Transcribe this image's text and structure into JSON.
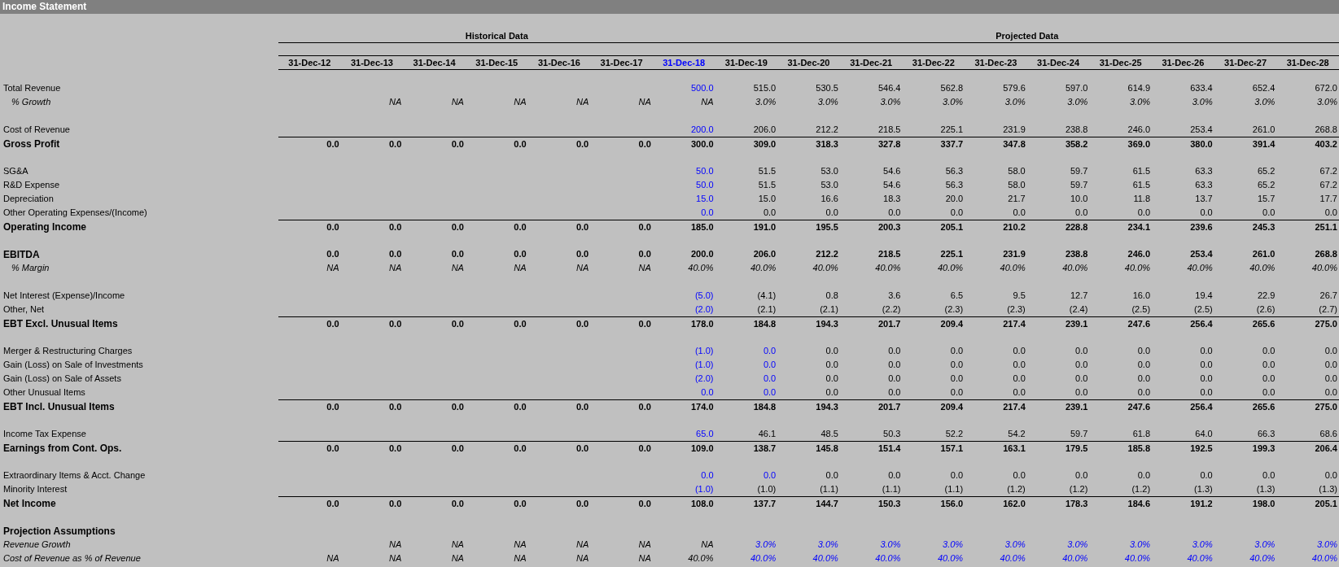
{
  "title": "Income Statement",
  "column_groups": [
    {
      "label": "Historical Data",
      "columns": [
        {
          "label": "31-Dec-12",
          "input": false
        },
        {
          "label": "31-Dec-13",
          "input": false
        },
        {
          "label": "31-Dec-14",
          "input": false
        },
        {
          "label": "31-Dec-15",
          "input": false
        },
        {
          "label": "31-Dec-16",
          "input": false
        },
        {
          "label": "31-Dec-17",
          "input": false
        },
        {
          "label": "31-Dec-18",
          "input": true
        }
      ]
    },
    {
      "label": "Projected Data",
      "columns": [
        {
          "label": "31-Dec-19",
          "input": false
        },
        {
          "label": "31-Dec-20",
          "input": false
        },
        {
          "label": "31-Dec-21",
          "input": false
        },
        {
          "label": "31-Dec-22",
          "input": false
        },
        {
          "label": "31-Dec-23",
          "input": false
        },
        {
          "label": "31-Dec-24",
          "input": false
        },
        {
          "label": "31-Dec-25",
          "input": false
        },
        {
          "label": "31-Dec-26",
          "input": false
        },
        {
          "label": "31-Dec-27",
          "input": false
        },
        {
          "label": "31-Dec-28",
          "input": false
        }
      ]
    }
  ],
  "rows": [
    {
      "kind": "item",
      "label": "Total Revenue",
      "cells": [
        null,
        null,
        null,
        null,
        null,
        null,
        {
          "text": "500.0",
          "input": true
        },
        "515.0",
        "530.5",
        "546.4",
        "562.8",
        "579.6",
        "597.0",
        "614.9",
        "633.4",
        "652.4",
        "672.0"
      ]
    },
    {
      "kind": "ratio",
      "label": "% Growth",
      "cells": [
        null,
        "NA",
        "NA",
        "NA",
        "NA",
        "NA",
        "NA",
        "3.0%",
        "3.0%",
        "3.0%",
        "3.0%",
        "3.0%",
        "3.0%",
        "3.0%",
        "3.0%",
        "3.0%",
        "3.0%"
      ]
    },
    {
      "kind": "spacer"
    },
    {
      "kind": "item",
      "label": "Cost of Revenue",
      "cells": [
        null,
        null,
        null,
        null,
        null,
        null,
        {
          "text": "200.0",
          "input": true
        },
        "206.0",
        "212.2",
        "218.5",
        "225.1",
        "231.9",
        "238.8",
        "246.0",
        "253.4",
        "261.0",
        "268.8"
      ]
    },
    {
      "kind": "total",
      "label": "Gross Profit",
      "cells": [
        "0.0",
        "0.0",
        "0.0",
        "0.0",
        "0.0",
        "0.0",
        "300.0",
        "309.0",
        "318.3",
        "327.8",
        "337.7",
        "347.8",
        "358.2",
        "369.0",
        "380.0",
        "391.4",
        "403.2"
      ]
    },
    {
      "kind": "spacer"
    },
    {
      "kind": "item",
      "label": "SG&A",
      "cells": [
        null,
        null,
        null,
        null,
        null,
        null,
        {
          "text": "50.0",
          "input": true
        },
        "51.5",
        "53.0",
        "54.6",
        "56.3",
        "58.0",
        "59.7",
        "61.5",
        "63.3",
        "65.2",
        "67.2"
      ]
    },
    {
      "kind": "item",
      "label": "R&D Expense",
      "cells": [
        null,
        null,
        null,
        null,
        null,
        null,
        {
          "text": "50.0",
          "input": true
        },
        "51.5",
        "53.0",
        "54.6",
        "56.3",
        "58.0",
        "59.7",
        "61.5",
        "63.3",
        "65.2",
        "67.2"
      ]
    },
    {
      "kind": "item",
      "label": "Depreciation",
      "cells": [
        null,
        null,
        null,
        null,
        null,
        null,
        {
          "text": "15.0",
          "input": true
        },
        "15.0",
        "16.6",
        "18.3",
        "20.0",
        "21.7",
        "10.0",
        "11.8",
        "13.7",
        "15.7",
        "17.7"
      ]
    },
    {
      "kind": "item",
      "label": "Other Operating Expenses/(Income)",
      "cells": [
        null,
        null,
        null,
        null,
        null,
        null,
        {
          "text": "0.0",
          "input": true
        },
        "0.0",
        "0.0",
        "0.0",
        "0.0",
        "0.0",
        "0.0",
        "0.0",
        "0.0",
        "0.0",
        "0.0"
      ]
    },
    {
      "kind": "total",
      "label": "Operating Income",
      "cells": [
        "0.0",
        "0.0",
        "0.0",
        "0.0",
        "0.0",
        "0.0",
        "185.0",
        "191.0",
        "195.5",
        "200.3",
        "205.1",
        "210.2",
        "228.8",
        "234.1",
        "239.6",
        "245.3",
        "251.1"
      ]
    },
    {
      "kind": "spacer"
    },
    {
      "kind": "subtotal",
      "label": "EBITDA",
      "cells": [
        "0.0",
        "0.0",
        "0.0",
        "0.0",
        "0.0",
        "0.0",
        "200.0",
        "206.0",
        "212.2",
        "218.5",
        "225.1",
        "231.9",
        "238.8",
        "246.0",
        "253.4",
        "261.0",
        "268.8"
      ]
    },
    {
      "kind": "ratio",
      "label": "% Margin",
      "cells": [
        "NA",
        "NA",
        "NA",
        "NA",
        "NA",
        "NA",
        "40.0%",
        "40.0%",
        "40.0%",
        "40.0%",
        "40.0%",
        "40.0%",
        "40.0%",
        "40.0%",
        "40.0%",
        "40.0%",
        "40.0%"
      ]
    },
    {
      "kind": "spacer"
    },
    {
      "kind": "item",
      "label": "Net Interest (Expense)/Income",
      "cells": [
        null,
        null,
        null,
        null,
        null,
        null,
        {
          "text": "(5.0)",
          "input": true
        },
        "(4.1)",
        "0.8",
        "3.6",
        "6.5",
        "9.5",
        "12.7",
        "16.0",
        "19.4",
        "22.9",
        "26.7"
      ]
    },
    {
      "kind": "item",
      "label": "Other, Net",
      "cells": [
        null,
        null,
        null,
        null,
        null,
        null,
        {
          "text": "(2.0)",
          "input": true
        },
        "(2.1)",
        "(2.1)",
        "(2.2)",
        "(2.3)",
        "(2.3)",
        "(2.4)",
        "(2.5)",
        "(2.5)",
        "(2.6)",
        "(2.7)"
      ]
    },
    {
      "kind": "total",
      "label": "EBT Excl. Unusual Items",
      "cells": [
        "0.0",
        "0.0",
        "0.0",
        "0.0",
        "0.0",
        "0.0",
        "178.0",
        "184.8",
        "194.3",
        "201.7",
        "209.4",
        "217.4",
        "239.1",
        "247.6",
        "256.4",
        "265.6",
        "275.0"
      ]
    },
    {
      "kind": "spacer"
    },
    {
      "kind": "item",
      "label": "Merger & Restructuring Charges",
      "cells": [
        null,
        null,
        null,
        null,
        null,
        null,
        {
          "text": "(1.0)",
          "input": true
        },
        {
          "text": "0.0",
          "input": true
        },
        "0.0",
        "0.0",
        "0.0",
        "0.0",
        "0.0",
        "0.0",
        "0.0",
        "0.0",
        "0.0"
      ]
    },
    {
      "kind": "item",
      "label": "Gain (Loss) on Sale of Investments",
      "cells": [
        null,
        null,
        null,
        null,
        null,
        null,
        {
          "text": "(1.0)",
          "input": true
        },
        {
          "text": "0.0",
          "input": true
        },
        "0.0",
        "0.0",
        "0.0",
        "0.0",
        "0.0",
        "0.0",
        "0.0",
        "0.0",
        "0.0"
      ]
    },
    {
      "kind": "item",
      "label": "Gain (Loss) on Sale of Assets",
      "cells": [
        null,
        null,
        null,
        null,
        null,
        null,
        {
          "text": "(2.0)",
          "input": true
        },
        {
          "text": "0.0",
          "input": true
        },
        "0.0",
        "0.0",
        "0.0",
        "0.0",
        "0.0",
        "0.0",
        "0.0",
        "0.0",
        "0.0"
      ]
    },
    {
      "kind": "item",
      "label": "Other Unusual Items",
      "cells": [
        null,
        null,
        null,
        null,
        null,
        null,
        {
          "text": "0.0",
          "input": true
        },
        {
          "text": "0.0",
          "input": true
        },
        "0.0",
        "0.0",
        "0.0",
        "0.0",
        "0.0",
        "0.0",
        "0.0",
        "0.0",
        "0.0"
      ]
    },
    {
      "kind": "total",
      "label": "EBT Incl. Unusual Items",
      "cells": [
        "0.0",
        "0.0",
        "0.0",
        "0.0",
        "0.0",
        "0.0",
        "174.0",
        "184.8",
        "194.3",
        "201.7",
        "209.4",
        "217.4",
        "239.1",
        "247.6",
        "256.4",
        "265.6",
        "275.0"
      ]
    },
    {
      "kind": "spacer"
    },
    {
      "kind": "item",
      "label": "Income Tax Expense",
      "cells": [
        null,
        null,
        null,
        null,
        null,
        null,
        {
          "text": "65.0",
          "input": true
        },
        "46.1",
        "48.5",
        "50.3",
        "52.2",
        "54.2",
        "59.7",
        "61.8",
        "64.0",
        "66.3",
        "68.6"
      ]
    },
    {
      "kind": "total",
      "label": "Earnings from Cont. Ops.",
      "cells": [
        "0.0",
        "0.0",
        "0.0",
        "0.0",
        "0.0",
        "0.0",
        "109.0",
        "138.7",
        "145.8",
        "151.4",
        "157.1",
        "163.1",
        "179.5",
        "185.8",
        "192.5",
        "199.3",
        "206.4"
      ]
    },
    {
      "kind": "spacer"
    },
    {
      "kind": "item",
      "label": "Extraordinary Items & Acct. Change",
      "cells": [
        null,
        null,
        null,
        null,
        null,
        null,
        {
          "text": "0.0",
          "input": true
        },
        {
          "text": "0.0",
          "input": true
        },
        "0.0",
        "0.0",
        "0.0",
        "0.0",
        "0.0",
        "0.0",
        "0.0",
        "0.0",
        "0.0"
      ]
    },
    {
      "kind": "item",
      "label": "Minority Interest",
      "cells": [
        null,
        null,
        null,
        null,
        null,
        null,
        {
          "text": "(1.0)",
          "input": true
        },
        "(1.0)",
        "(1.1)",
        "(1.1)",
        "(1.1)",
        "(1.2)",
        "(1.2)",
        "(1.2)",
        "(1.3)",
        "(1.3)",
        "(1.3)"
      ]
    },
    {
      "kind": "total",
      "label": "Net Income",
      "cells": [
        "0.0",
        "0.0",
        "0.0",
        "0.0",
        "0.0",
        "0.0",
        "108.0",
        "137.7",
        "144.7",
        "150.3",
        "156.0",
        "162.0",
        "178.3",
        "184.6",
        "191.2",
        "198.0",
        "205.1"
      ]
    },
    {
      "kind": "spacer"
    },
    {
      "kind": "section",
      "label": "Projection Assumptions"
    },
    {
      "kind": "assumption",
      "label": "Revenue Growth",
      "cells": [
        null,
        "NA",
        "NA",
        "NA",
        "NA",
        "NA",
        "NA",
        {
          "text": "3.0%",
          "input": true
        },
        {
          "text": "3.0%",
          "input": true
        },
        {
          "text": "3.0%",
          "input": true
        },
        {
          "text": "3.0%",
          "input": true
        },
        {
          "text": "3.0%",
          "input": true
        },
        {
          "text": "3.0%",
          "input": true
        },
        {
          "text": "3.0%",
          "input": true
        },
        {
          "text": "3.0%",
          "input": true
        },
        {
          "text": "3.0%",
          "input": true
        },
        {
          "text": "3.0%",
          "input": true
        }
      ]
    },
    {
      "kind": "assumption",
      "label": "Cost of Revenue as % of Revenue",
      "cells": [
        "NA",
        "NA",
        "NA",
        "NA",
        "NA",
        "NA",
        "40.0%",
        {
          "text": "40.0%",
          "input": true
        },
        {
          "text": "40.0%",
          "input": true
        },
        {
          "text": "40.0%",
          "input": true
        },
        {
          "text": "40.0%",
          "input": true
        },
        {
          "text": "40.0%",
          "input": true
        },
        {
          "text": "40.0%",
          "input": true
        },
        {
          "text": "40.0%",
          "input": true
        },
        {
          "text": "40.0%",
          "input": true
        },
        {
          "text": "40.0%",
          "input": true
        },
        {
          "text": "40.0%",
          "input": true
        }
      ]
    }
  ]
}
